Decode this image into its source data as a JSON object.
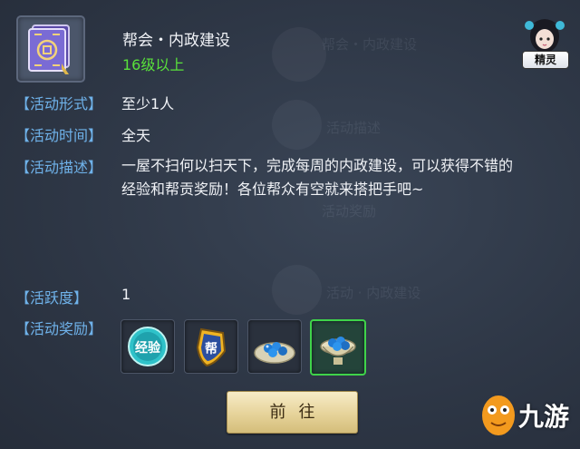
{
  "header": {
    "title": "帮会・内政建设",
    "level_requirement": "16级以上",
    "spirit_badge": "精灵"
  },
  "details": [
    {
      "label": "【活动形式】",
      "value": "至少1人"
    },
    {
      "label": "【活动时间】",
      "value": "全天"
    },
    {
      "label": "【活动描述】",
      "value": "一屋不扫何以扫天下，完成每周的内政建设，可以获得不错的经验和帮贡奖励！各位帮众有空就来搭把手吧~"
    },
    {
      "label": "【活跃度】",
      "value": "1"
    },
    {
      "label": "【活动奖励】",
      "value": ""
    }
  ],
  "rewards": [
    {
      "name": "exp-orb-icon",
      "text": "经验"
    },
    {
      "name": "guild-badge-icon",
      "text": "帮"
    },
    {
      "name": "blue-pearls-plate-icon"
    },
    {
      "name": "blue-pearls-bowl-icon"
    }
  ],
  "action": {
    "go_label": "前往"
  },
  "watermark": {
    "text": "九游"
  },
  "colors": {
    "label_blue": "#6fb2ea",
    "level_green": "#59e13b",
    "selected_border": "#3fd34a",
    "button_gold": "#e6d39a"
  }
}
